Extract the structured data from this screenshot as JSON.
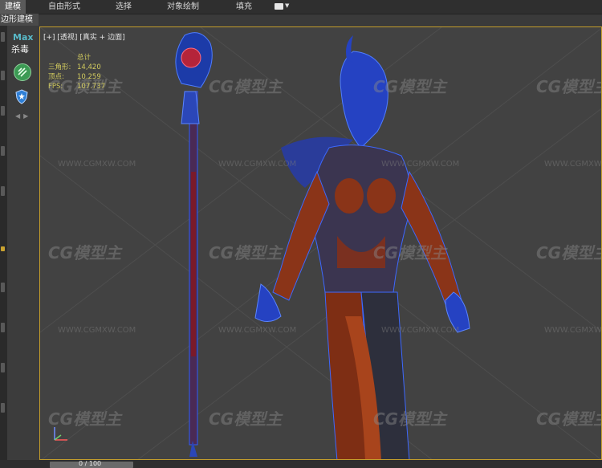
{
  "ribbon": {
    "tabs": [
      {
        "label": "建模",
        "active": true
      },
      {
        "label": "自由形式",
        "active": false
      },
      {
        "label": "选择",
        "active": false
      },
      {
        "label": "对象绘制",
        "active": false
      },
      {
        "label": "填充",
        "active": false
      }
    ],
    "toggle_icon": "ribbon-display-toggle"
  },
  "subribbon": {
    "label": "边形建模"
  },
  "leftpanel": {
    "logo": "Max",
    "antivirus_label": "杀毒",
    "icons": [
      "clean-icon",
      "shield-icon",
      "nav-arrows-icon"
    ]
  },
  "viewport": {
    "label": "[+] [透视] [真实 + 边面]",
    "stats": {
      "header": "总计",
      "rows": [
        {
          "key": "三角形:",
          "value": "14,420"
        },
        {
          "key": "顶点:",
          "value": "10,259"
        },
        {
          "key": "FPS:",
          "value": "107.737"
        }
      ]
    },
    "watermark_logo": "CG模型主",
    "watermark_url": "WWW.CGMXW.COM",
    "accent_border": "#c39d2c"
  },
  "timeline": {
    "frame_label": "0 / 100"
  },
  "colors": {
    "stats_text": "#d2cb5e",
    "wire": "#2f5cff",
    "skin": "#8a3418"
  }
}
